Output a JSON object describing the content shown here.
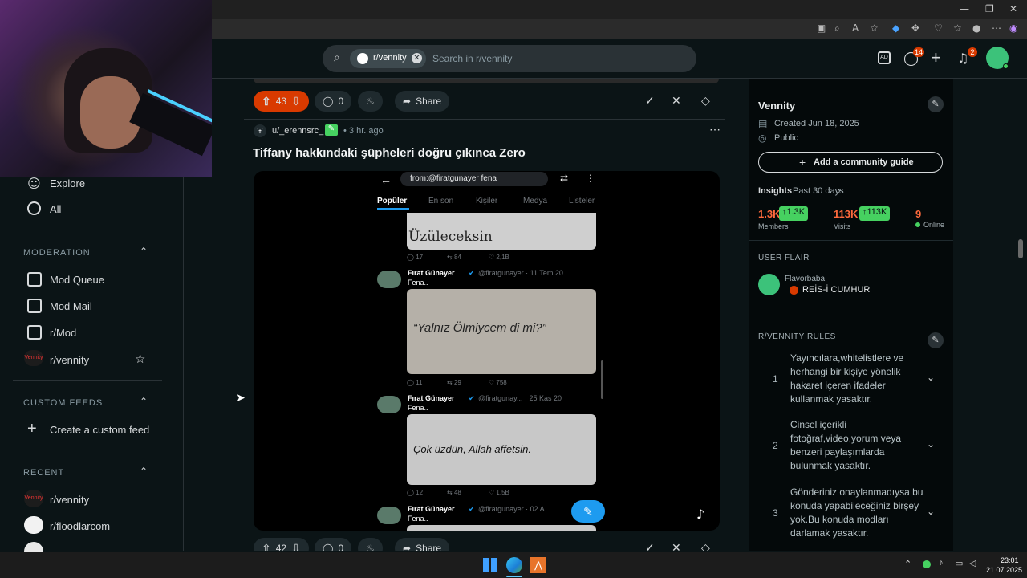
{
  "reddit_header": {
    "community_chip": "r/vennity",
    "search_placeholder": "Search in r/vennity",
    "chat_badge": "14",
    "notif_badge": "2"
  },
  "sidebar": {
    "explore": "Explore",
    "all": "All",
    "moderation_header": "MODERATION",
    "mod_queue": "Mod Queue",
    "mod_mail": "Mod Mail",
    "r_mod": "r/Mod",
    "r_vennity": "r/vennity",
    "custom_feeds_header": "CUSTOM FEEDS",
    "create_custom_feed": "Create a custom feed",
    "recent_header": "RECENT",
    "recent_1": "r/vennity",
    "recent_2": "r/floodlarcom"
  },
  "prev_post_actions": {
    "votes": "43",
    "comments": "0",
    "share": "Share"
  },
  "post": {
    "author": "u/_erennsrc_",
    "time": "• 3 hr. ago",
    "title": "Tiffany hakkındaki şüpheleri doğru çıkınca Zero"
  },
  "embedded_screenshot": {
    "search_text": "from:@firatgunayer fena",
    "tabs": [
      "Popüler",
      "En son",
      "Kişiler",
      "Medya",
      "Listeler"
    ],
    "top_image_text": "Üzüleceksin",
    "tweet1_stats": [
      "17",
      "84",
      "2,1B"
    ],
    "tweet2_name": "Fırat Günayer",
    "tweet2_handle": "@firatgunayer · 11 Tem 20",
    "tweet2_text": "Fena..",
    "tweet2_image_text": "“Yalnız Ölmiycem di mi?”",
    "tweet2_stats": [
      "11",
      "29",
      "758"
    ],
    "tweet3_name": "Fırat Günayer",
    "tweet3_handle": "@firatgunay... · 25 Kas 20",
    "tweet3_text": "Fena..",
    "tweet3_image_text": "Çok üzdün, Allah affetsin.",
    "tweet3_stats": [
      "12",
      "48",
      "1,5B"
    ],
    "tweet4_name": "Fırat Günayer",
    "tweet4_handle": "@firatgunayer · 02 A",
    "tweet4_text": "Fena.."
  },
  "next_post_actions": {
    "votes": "42",
    "comments": "0",
    "share": "Share"
  },
  "right_panel": {
    "community_name": "Vennity",
    "created": "Created Jun 18, 2025",
    "visibility": "Public",
    "add_guide": "Add a community guide",
    "insights": "Insights",
    "insights_period": "Past 30 days",
    "members_value": "1.3K",
    "members_delta": "↑1.3K",
    "members_label": "Members",
    "visits_value": "113K",
    "visits_delta": "↑113K",
    "visits_label": "Visits",
    "online_value": "9",
    "online_label": "Online",
    "user_flair_header": "USER FLAIR",
    "flair_user": "Flavorbaba",
    "flair_text": "REİS-İ CUMHUR",
    "rules_header": "R/VENNITY RULES",
    "rules": [
      {
        "num": "1",
        "text": "Yayıncılara,whitelistlere ve herhangi bir kişiye yönelik hakaret içeren ifadeler kullanmak yasaktır."
      },
      {
        "num": "2",
        "text": "Cinsel içerikli fotoğraf,video,yorum veya benzeri paylaşımlarda bulunmak yasaktır."
      },
      {
        "num": "3",
        "text": "Gönderiniz onaylanmadıysa bu konuda yapabileceğiniz birşey yok.Bu konuda modları darlamak yasaktır."
      }
    ]
  },
  "taskbar": {
    "time": "23:01",
    "date": "21.07.2025"
  },
  "colors": {
    "upvote_active": "#d93a00",
    "accent_green": "#46d160",
    "background": "#0b1416"
  }
}
